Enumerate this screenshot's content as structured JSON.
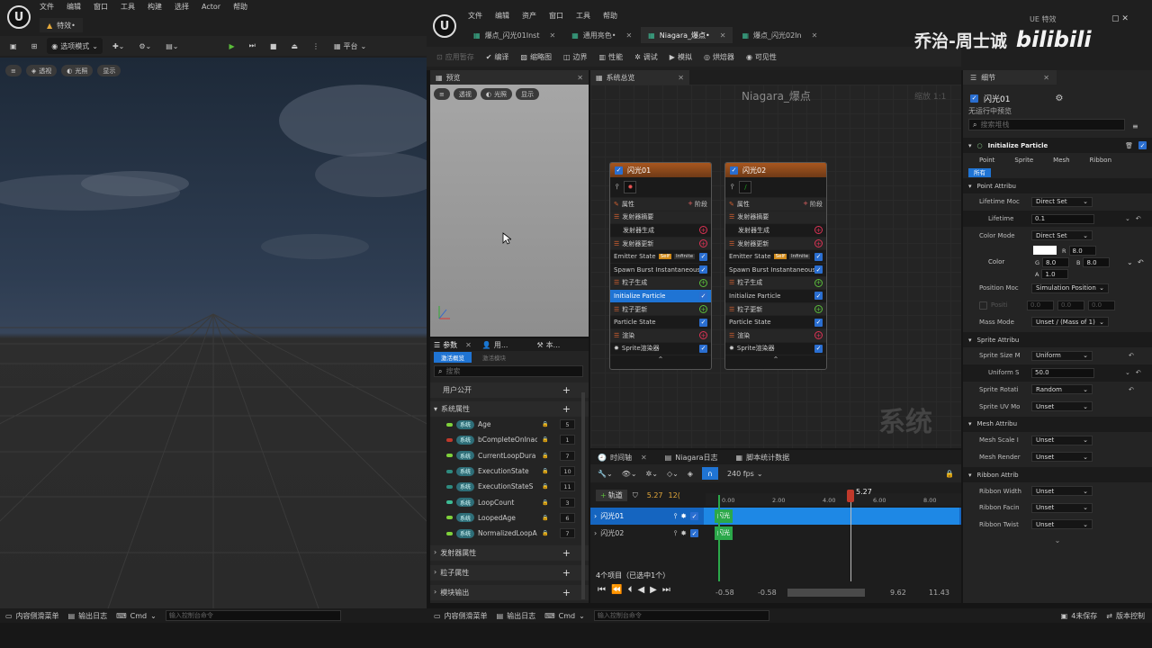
{
  "left_window": {
    "menu": [
      "文件",
      "编辑",
      "窗口",
      "工具",
      "构建",
      "选择",
      "Actor",
      "帮助"
    ],
    "tab_title": "特效•",
    "mode_label": "选项模式",
    "platform_label": "平台",
    "viewport_buttons": [
      "透视",
      "光照",
      "显示"
    ]
  },
  "right_window": {
    "menu": [
      "文件",
      "编辑",
      "资产",
      "窗口",
      "工具",
      "帮助"
    ],
    "asset_tabs": [
      "爆点_闪光01Inst",
      "通用亮色•",
      "Niagara_爆点•",
      "爆点_闪光02In"
    ],
    "ue_badge": "UE 特效",
    "toolbar": [
      "应用暂存",
      "编译",
      "缩略图",
      "边界",
      "性能",
      "调试",
      "模拟",
      "烘焙器",
      "可见性"
    ]
  },
  "watermark": {
    "author": "乔治-周士诚",
    "site": "bilibili"
  },
  "preview": {
    "title": "预览",
    "buttons": [
      "透视",
      "光照",
      "显示"
    ]
  },
  "system_overview": {
    "title": "系统总览",
    "graph_title": "Niagara_爆点",
    "zoom": "缩放 1:1",
    "graph_watermark": "系统"
  },
  "emitters": [
    {
      "name": "闪光01",
      "rows": [
        {
          "label": "属性",
          "kind": "head",
          "extra": "阶段"
        },
        {
          "label": "发射器摘要",
          "kind": "grp"
        },
        {
          "label": "发射器生成",
          "kind": "sub",
          "ind": "add"
        },
        {
          "label": "发射器更新",
          "kind": "grp",
          "ind": "add"
        },
        {
          "label": "Emitter State",
          "kind": "item",
          "tag": "Self",
          "tag2": "Infinite",
          "ind": "check"
        },
        {
          "label": "Spawn Burst Instantaneous",
          "kind": "item",
          "ind": "check"
        },
        {
          "label": "粒子生成",
          "kind": "grp",
          "ind": "addg"
        },
        {
          "label": "Initialize Particle",
          "kind": "sel",
          "ind": "check"
        },
        {
          "label": "粒子更新",
          "kind": "grp",
          "ind": "addg"
        },
        {
          "label": "Particle State",
          "kind": "item",
          "ind": "check"
        },
        {
          "label": "渲染",
          "kind": "grp",
          "ind": "add"
        },
        {
          "label": "Sprite渲染器",
          "kind": "item",
          "ind": "check"
        }
      ]
    },
    {
      "name": "闪光02",
      "rows": [
        {
          "label": "属性",
          "kind": "head",
          "extra": "阶段"
        },
        {
          "label": "发射器摘要",
          "kind": "grp"
        },
        {
          "label": "发射器生成",
          "kind": "sub",
          "ind": "add"
        },
        {
          "label": "发射器更新",
          "kind": "grp",
          "ind": "add"
        },
        {
          "label": "Emitter State",
          "kind": "item",
          "tag": "Self",
          "tag2": "Infinite",
          "ind": "check"
        },
        {
          "label": "Spawn Burst Instantaneous",
          "kind": "item",
          "ind": "check"
        },
        {
          "label": "粒子生成",
          "kind": "grp",
          "ind": "addg"
        },
        {
          "label": "Initialize Particle",
          "kind": "item",
          "ind": "check"
        },
        {
          "label": "粒子更新",
          "kind": "grp",
          "ind": "addg"
        },
        {
          "label": "Particle State",
          "kind": "item",
          "ind": "check"
        },
        {
          "label": "渲染",
          "kind": "grp",
          "ind": "add"
        },
        {
          "label": "Sprite渲染器",
          "kind": "item",
          "ind": "check"
        }
      ]
    }
  ],
  "params_panel": {
    "tabs": [
      "参数",
      "用...",
      "本..."
    ],
    "filters": [
      "激活概览",
      "激活模块"
    ],
    "search_placeholder": "搜索",
    "user_exposed": "用户公开",
    "system_attrs": "系统属性",
    "sys_badge": "系统",
    "params": [
      {
        "name": "Age",
        "color": "#7fd13b",
        "count": "5"
      },
      {
        "name": "bCompleteOnInac",
        "color": "#c0392b",
        "count": "1"
      },
      {
        "name": "CurrentLoopDura",
        "color": "#7fd13b",
        "count": "7"
      },
      {
        "name": "ExecutionState",
        "color": "#2e8b80",
        "count": "10"
      },
      {
        "name": "ExecutionStateS",
        "color": "#2e8b80",
        "count": "11"
      },
      {
        "name": "LoopCount",
        "color": "#3dbb94",
        "count": "3"
      },
      {
        "name": "LoopedAge",
        "color": "#7fd13b",
        "count": "6"
      },
      {
        "name": "NormalizedLoopA",
        "color": "#7fd13b",
        "count": "7"
      }
    ],
    "sections": [
      "发射器属性",
      "粒子属性",
      "模块输出"
    ]
  },
  "details": {
    "title": "细节",
    "emitter_name": "闪光01",
    "preview_note": "无运行中预览",
    "search_placeholder": "搜索堆栈",
    "module": "Initialize Particle",
    "filters": [
      "Point",
      "Sprite",
      "Mesh",
      "Ribbon"
    ],
    "all": "所有",
    "point_section": "Point Attribu",
    "lifetime_mode_label": "Lifetime Moc",
    "lifetime_mode": "Direct Set",
    "lifetime_label": "Lifetime",
    "lifetime_value": "0.1",
    "color_mode_label": "Color Mode",
    "color_mode": "Direct Set",
    "color_label": "Color",
    "color": {
      "r": "8.0",
      "g": "8.0",
      "b": "8.0",
      "a": "1.0"
    },
    "position_mode_label": "Position Moc",
    "position_mode": "Simulation Position",
    "position_label": "Positi",
    "position": [
      "0.0",
      "0.0",
      "0.0"
    ],
    "mass_mode_label": "Mass Mode",
    "mass_mode": "Unset / (Mass of 1)",
    "sprite_section": "Sprite Attribu",
    "sprite_size_mode_label": "Sprite Size M",
    "sprite_size_mode": "Uniform",
    "uniform_label": "Uniform S",
    "uniform_value": "50.0",
    "sprite_rot_label": "Sprite Rotati",
    "sprite_rot_mode": "Random",
    "sprite_uv_label": "Sprite UV Mo",
    "sprite_uv_mode": "Unset",
    "mesh_section": "Mesh Attribu",
    "mesh_scale_label": "Mesh Scale I",
    "mesh_scale_mode": "Unset",
    "mesh_render_label": "Mesh Render",
    "mesh_render_mode": "Unset",
    "ribbon_section": "Ribbon Attrib",
    "ribbon_width_label": "Ribbon Width",
    "ribbon_width_mode": "Unset",
    "ribbon_facing_label": "Ribbon Facin",
    "ribbon_facing_mode": "Unset",
    "ribbon_twist_label": "Ribbon Twist",
    "ribbon_twist_mode": "Unset"
  },
  "timeline": {
    "tabs": [
      "时间轴",
      "Niagara日志",
      "脚本统计数据"
    ],
    "fps": "240 fps",
    "track_btn": "轨道",
    "current_time": "5.27",
    "time_short": "12(",
    "tracks": [
      "闪光01",
      "闪光02"
    ],
    "track_bar_label": "闪光",
    "ticks": [
      "0.00",
      "2.00",
      "4.00",
      "6.00",
      "8.00"
    ],
    "playhead": "5.27",
    "items_text": "4个项目（已选中1个）",
    "range_start": "-0.58",
    "range_start2": "-0.58",
    "range_end": "9.62",
    "range_end2": "11.43"
  },
  "status_left": {
    "drawer": "内容侧滑菜单",
    "log": "输出日志",
    "cmd": "Cmd",
    "console_placeholder": "输入控制台命令"
  },
  "status_right": {
    "drawer": "内容侧滑菜单",
    "log": "输出日志",
    "cmd": "Cmd",
    "console_placeholder": "输入控制台命令",
    "unsaved": "4未保存",
    "source": "版本控制"
  },
  "colors": {
    "accent": "#1f74d4",
    "emitter_header": "#a8571f",
    "track_blue": "#1e88e5",
    "track_green": "#2ba84a"
  }
}
